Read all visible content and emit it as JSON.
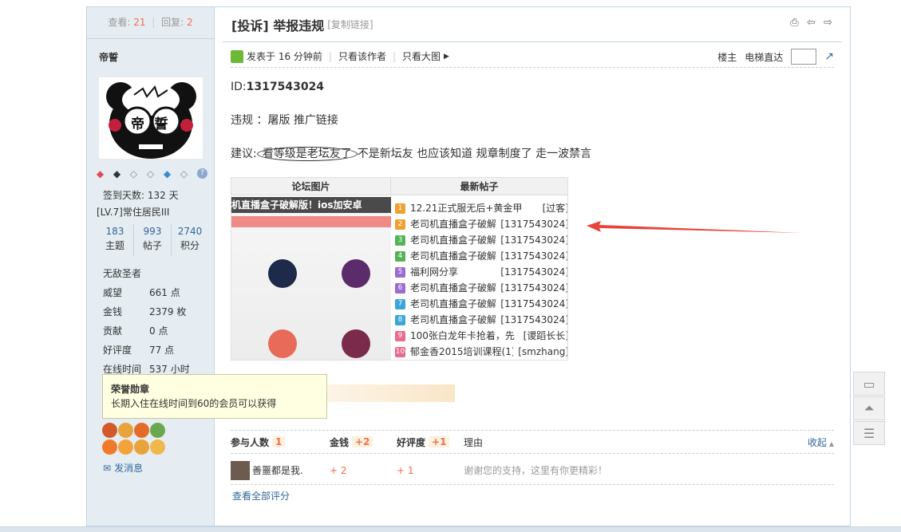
{
  "sidebar": {
    "stats": {
      "views_label": "查看:",
      "views": "21",
      "replies_label": "回复:",
      "replies": "2"
    },
    "author": "帝誓",
    "avatar_text": "帝_誓",
    "signin_label": "签到天数: 132 天",
    "level": "[LV.7]常住居民III",
    "counts": [
      {
        "value": "183",
        "label": "主题"
      },
      {
        "value": "993",
        "label": "帖子"
      },
      {
        "value": "2740",
        "label": "积分"
      }
    ],
    "title_rank": "无敌圣者",
    "profile": [
      {
        "key": "威望",
        "value": "661 点"
      },
      {
        "key": "金钱",
        "value": "2379 枚"
      },
      {
        "key": "贡献",
        "value": "0 点"
      },
      {
        "key": "好评度",
        "value": "77 点"
      },
      {
        "key": "在线时间",
        "value": "537 小时"
      }
    ],
    "send_message": "发消息"
  },
  "tooltip": {
    "title": "荣誉勋章",
    "body": "长期入住在线时间到60的会员可以获得"
  },
  "post": {
    "title": "[投诉] 举报违规",
    "copy_link": "[复制链接]",
    "posted": "发表于 16 分钟前",
    "only_author": "只看该作者",
    "big_image": "只看大图",
    "floor": "楼主",
    "elevator": "电梯直达",
    "id_label": "ID:",
    "id_value": "1317543024",
    "violation": "违规 ：屠版 推广链接",
    "suggest_prefix": "建议:",
    "suggest_circled": "看等级是老坛友了",
    "suggest_rest": "不是新坛友 也应该知道 规章制度了 走一波禁言"
  },
  "embed": {
    "left_header": "论坛图片",
    "right_header": "最新帖子",
    "banner": "机直播盒子破解版！ios加安卓",
    "items": [
      {
        "no": "1",
        "color": "#f0a030",
        "title": "12.21正式服无后+黄金甲",
        "who": "[过客]"
      },
      {
        "no": "2",
        "color": "#f0a030",
        "title": "老司机直播盒子破解",
        "who": "[1317543024]"
      },
      {
        "no": "3",
        "color": "#56b256",
        "title": "老司机直播盒子破解",
        "who": "[1317543024]"
      },
      {
        "no": "4",
        "color": "#56b256",
        "title": "老司机直播盒子破解",
        "who": "[1317543024]"
      },
      {
        "no": "5",
        "color": "#9b6bd0",
        "title": "福利网分享",
        "who": "[1317543024]"
      },
      {
        "no": "6",
        "color": "#9b6bd0",
        "title": "老司机直播盒子破解",
        "who": "[1317543024]"
      },
      {
        "no": "7",
        "color": "#3ba6d8",
        "title": "老司机直播盒子破解",
        "who": "[1317543024]"
      },
      {
        "no": "8",
        "color": "#3ba6d8",
        "title": "老司机直播盒子破解",
        "who": "[1317543024]"
      },
      {
        "no": "9",
        "color": "#e86a8c",
        "title": "100张白龙年卡抢着，先",
        "who": "[谡蹈长长]"
      },
      {
        "no": "10",
        "color": "#e86a8c",
        "title": "郁金香2015培训课程(1)",
        "who": "[smzhang]"
      }
    ]
  },
  "rating": {
    "participants_label": "参与人数",
    "participants": "1",
    "money_label": "金钱",
    "money": "+2",
    "rep_label": "好评度",
    "rep": "+1",
    "reason_label": "理由",
    "collapse": "收起",
    "row": {
      "user": "善噩都是我.",
      "money": "+ 2",
      "rep": "+ 1",
      "reason": "谢谢您的支持，这里有你更精彩！"
    },
    "see_all": "查看全部评分"
  },
  "colors": {
    "accent": "#f26c4f",
    "link": "#336699",
    "border": "#c2d5e3",
    "arrow": "#e8443a"
  }
}
